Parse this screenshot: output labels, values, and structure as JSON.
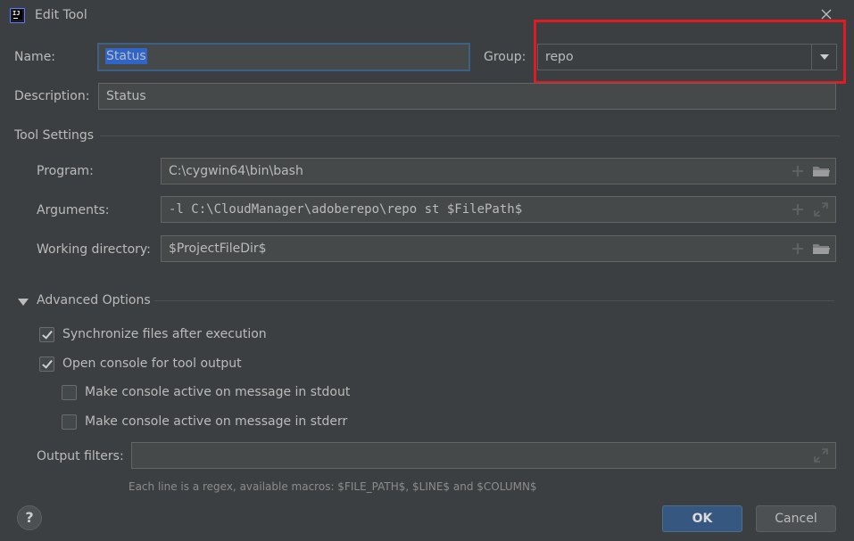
{
  "window": {
    "title": "Edit Tool"
  },
  "form": {
    "name_label": "Name:",
    "name_value": "Status",
    "group_label": "Group:",
    "group_value": "repo",
    "description_label": "Description:",
    "description_value": "Status"
  },
  "tool_settings": {
    "title": "Tool Settings",
    "program_label": "Program:",
    "program_value": "C:\\cygwin64\\bin\\bash",
    "arguments_label": "Arguments:",
    "arguments_value": "-l C:\\CloudManager\\adoberepo\\repo st $FilePath$",
    "working_dir_label": "Working directory:",
    "working_dir_value": "$ProjectFileDir$"
  },
  "advanced": {
    "title": "Advanced Options",
    "options": [
      {
        "label": "Synchronize files after execution",
        "checked": true
      },
      {
        "label": "Open console for tool output",
        "checked": true
      },
      {
        "label": "Make console active on message in stdout",
        "checked": false
      },
      {
        "label": "Make console active on message in stderr",
        "checked": false
      }
    ],
    "output_filters_label": "Output filters:",
    "output_filters_value": "",
    "hint": "Each line is a regex, available macros: $FILE_PATH$, $LINE$ and $COLUMN$"
  },
  "buttons": {
    "help": "?",
    "ok": "OK",
    "cancel": "Cancel"
  },
  "colors": {
    "background": "#3c3f41",
    "selection": "#2f65ca",
    "focus": "#3d6185",
    "highlight": "#e01b24",
    "primary_button": "#365880"
  }
}
